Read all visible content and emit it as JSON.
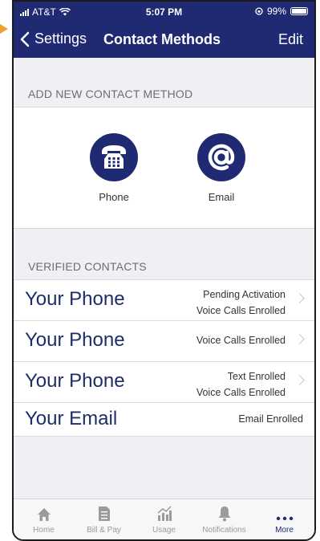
{
  "status_bar": {
    "carrier": "AT&T",
    "time": "5:07 PM",
    "battery": "99%"
  },
  "nav": {
    "back_label": "Settings",
    "title": "Contact Methods",
    "edit_label": "Edit"
  },
  "add_section": {
    "header": "ADD NEW CONTACT METHOD",
    "methods": [
      {
        "label": "Phone",
        "icon": "telephone-icon"
      },
      {
        "label": "Email",
        "icon": "at-sign-icon"
      }
    ]
  },
  "verified_section": {
    "header": "VERIFIED CONTACTS",
    "contacts": [
      {
        "name": "Your Phone",
        "status_line1": "Pending Activation",
        "status_line2": "Voice Calls Enrolled"
      },
      {
        "name": "Your Phone",
        "status_line1": "Voice Calls Enrolled"
      },
      {
        "name": "Your Phone",
        "status_line1": "Text Enrolled",
        "status_line2": "Voice Calls Enrolled"
      },
      {
        "name": "Your Email",
        "status_line1": "Email Enrolled"
      }
    ]
  },
  "tabs": [
    {
      "label": "Home",
      "icon": "home-icon"
    },
    {
      "label": "Bill & Pay",
      "icon": "bill-icon"
    },
    {
      "label": "Usage",
      "icon": "usage-chart-icon"
    },
    {
      "label": "Notifications",
      "icon": "bell-icon"
    },
    {
      "label": "More",
      "icon": "more-dots-icon",
      "active": true
    }
  ],
  "colors": {
    "brand_navy": "#1f2a73",
    "callout_arrow": "#f0a030"
  }
}
